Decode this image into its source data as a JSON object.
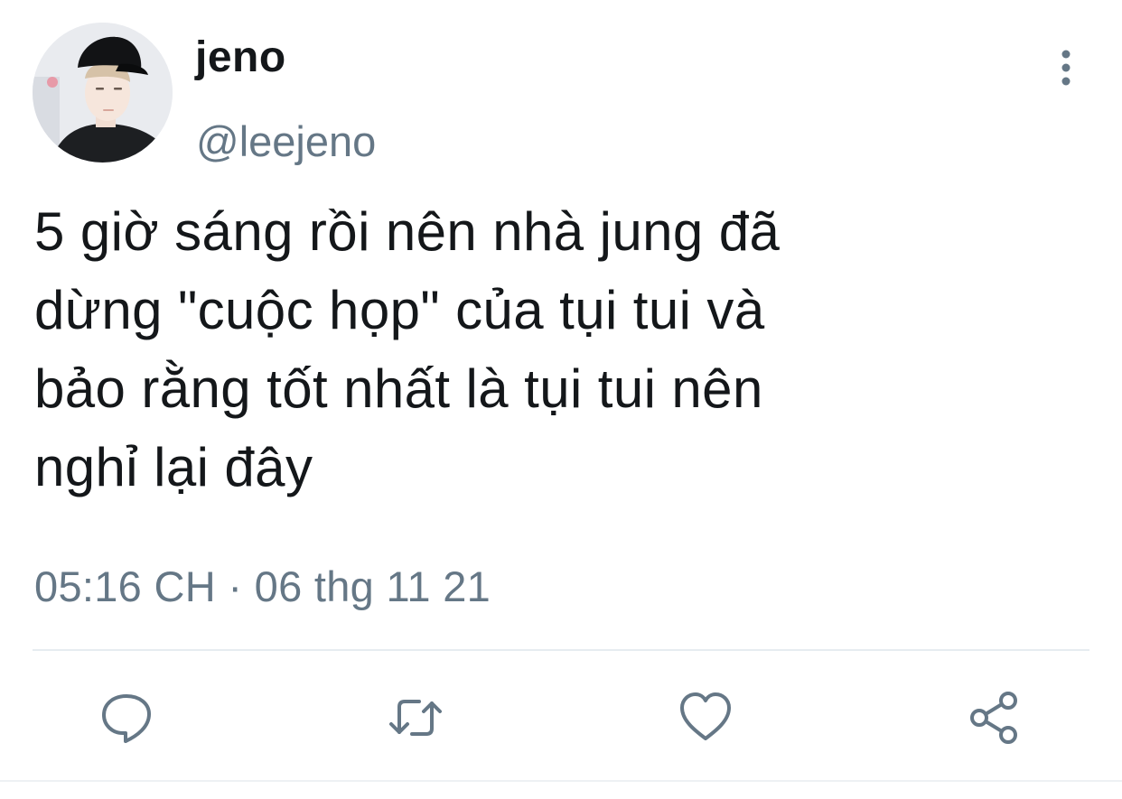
{
  "user": {
    "display_name": "jeno",
    "handle": "@leejeno"
  },
  "tweet": {
    "text": "5 giờ sáng rồi nên nhà jung đã\ndừng \"cuộc họp\" của tụi tui và\nbảo rằng tốt nhất là tụi tui nên\nnghỉ lại đây",
    "timestamp": "05:16 CH · 06 thg 11 21"
  },
  "icons": {
    "more": "more-vertical-icon",
    "reply": "reply-icon",
    "retweet": "retweet-icon",
    "like": "heart-icon",
    "share": "share-icon"
  },
  "colors": {
    "text": "#14171a",
    "secondary": "#657786",
    "divider": "#e6ecf0"
  }
}
